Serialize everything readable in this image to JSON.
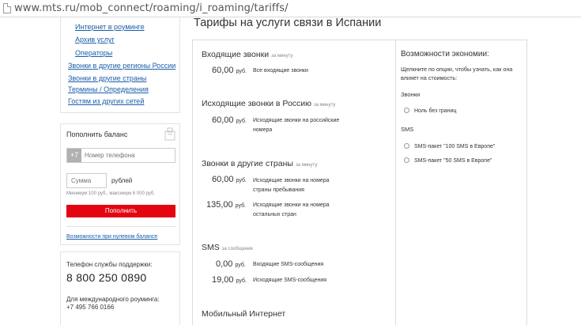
{
  "browser": {
    "url": "www.mts.ru/mob_connect/roaming/i_roaming/tariffs/"
  },
  "sidebar": {
    "sub_links": [
      "Интернет в роуминге",
      "Архив услуг",
      "Операторы"
    ],
    "links": [
      "Звонки в другие регионы России",
      "Звонки в другие страны",
      "Термины / Определения",
      "Гостям из других сетей"
    ]
  },
  "balance": {
    "title": "Пополнить баланс",
    "phone_prefix": "+7",
    "phone_placeholder": "Номер телефона",
    "sum_placeholder": "Сумма",
    "currency_label": "рублей",
    "limits": "Минимум 100 руб., максимум 6 000 руб.",
    "pay_button": "Пополнить",
    "zero_balance_link": "Возможности при нулевом балансе"
  },
  "support": {
    "label": "Телефон службы поддержки:",
    "phone": "8 800 250 0890",
    "intl_label": "Для международного роуминга:",
    "intl_phone": "+7 495 766 0166"
  },
  "main": {
    "title": "Тарифы на услуги связи в Испании",
    "sections": [
      {
        "title": "Входящие звонки",
        "unit": "за минуту",
        "rows": [
          {
            "price": "60,00",
            "currency": "руб.",
            "desc": "Все входящие звонки"
          }
        ]
      },
      {
        "title": "Исходящие звонки в Россию",
        "unit": "за минуту",
        "rows": [
          {
            "price": "60,00",
            "currency": "руб.",
            "desc": "Исходящие звонки на российские номера"
          }
        ]
      },
      {
        "title": "Звонки в другие страны",
        "unit": "за минуту",
        "rows": [
          {
            "price": "60,00",
            "currency": "руб.",
            "desc": "Исходящие звонки на номера страны пребывания"
          },
          {
            "price": "135,00",
            "currency": "руб.",
            "desc": "Исходящие звонки на номера остальных стран"
          }
        ]
      },
      {
        "title": "SMS",
        "unit": "за сообщение",
        "rows": [
          {
            "price": "0,00",
            "currency": "руб.",
            "desc": "Входящие SMS-сообщения"
          },
          {
            "price": "19,00",
            "currency": "руб.",
            "desc": "Исходящие SMS-сообщения"
          }
        ]
      },
      {
        "title": "Мобильный Интернет",
        "unit": "",
        "rows": []
      }
    ]
  },
  "savings": {
    "title": "Возможности экономии:",
    "hint": "Щелкните по опции, чтобы узнать, как она влияет на стоимость:",
    "groups": [
      {
        "name": "Звонки",
        "options": [
          "Ноль без границ"
        ]
      },
      {
        "name": "SMS",
        "options": [
          "SMS-пакет \"100 SMS в Европе\"",
          "SMS-пакет \"50 SMS в Европе\""
        ]
      }
    ]
  },
  "colors": {
    "link": "#1a5ea8",
    "brand_red": "#e30611",
    "border": "#dcdcdc"
  }
}
